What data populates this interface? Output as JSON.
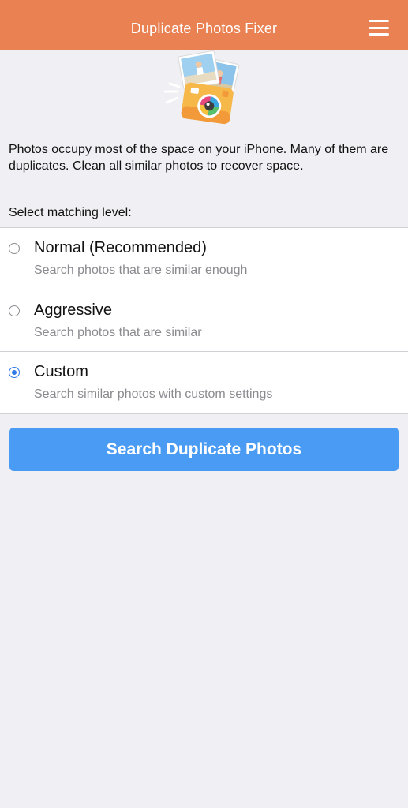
{
  "header": {
    "title": "Duplicate Photos Fixer",
    "menu_icon": "hamburger-menu-icon",
    "background_color": "#e98152"
  },
  "hero": {
    "icon": "camera-photos-illustration"
  },
  "intro": {
    "text": "Photos occupy most of the space on your iPhone. Many of them are duplicates. Clean all similar photos to recover space."
  },
  "matching": {
    "label": "Select matching level:",
    "options": [
      {
        "title": "Normal (Recommended)",
        "subtitle": "Search photos that are similar enough",
        "selected": false
      },
      {
        "title": "Aggressive",
        "subtitle": "Search photos that are similar",
        "selected": false
      },
      {
        "title": "Custom",
        "subtitle": "Search similar photos with custom settings",
        "selected": true
      }
    ]
  },
  "actions": {
    "search_label": "Search Duplicate Photos",
    "button_color": "#4a9bf3"
  }
}
